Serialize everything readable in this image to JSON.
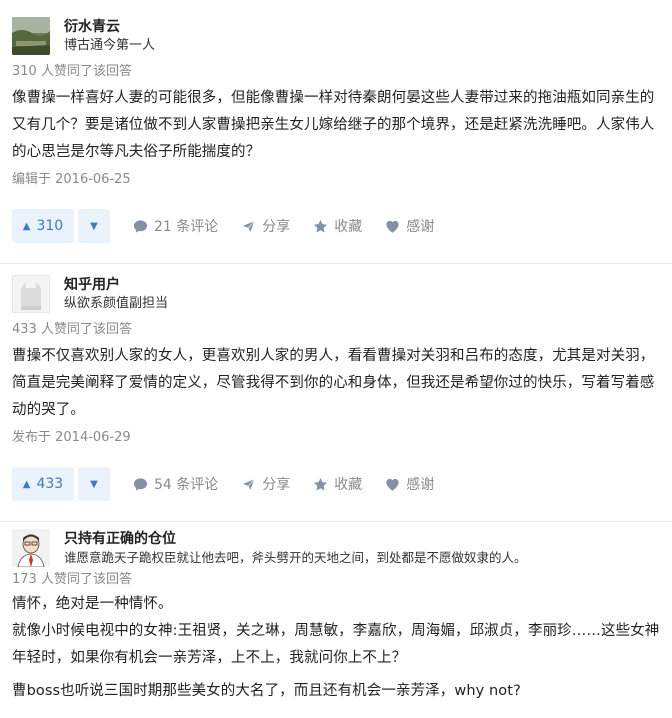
{
  "answers": [
    {
      "author": {
        "name": "衍水青云",
        "bio": "博古通今第一人"
      },
      "votes_line": "310 人赞同了该回答",
      "content": [
        "像曹操一样喜好人妻的可能很多，但能像曹操一样对待秦朗何晏这些人妻带过来的拖油瓶如同亲生的又有几个？要是诸位做不到人家曹操把亲生女儿嫁给继子的那个境界，还是赶紧洗洗睡吧。人家伟人的心思岂是尔等凡夫俗子所能揣度的？"
      ],
      "date": "编辑于 2016-06-25",
      "upvotes": "310",
      "comments": "21 条评论",
      "share": "分享",
      "favorite": "收藏",
      "thanks": "感谢"
    },
    {
      "author": {
        "name": "知乎用户",
        "bio": "纵欲系颜值副担当"
      },
      "votes_line": "433 人赞同了该回答",
      "content": [
        "曹操不仅喜欢别人家的女人，更喜欢别人家的男人，看看曹操对关羽和吕布的态度，尤其是对关羽，简直是完美阐释了爱情的定义，尽管我得不到你的心和身体，但我还是希望你过的快乐，写着写着感动的哭了。"
      ],
      "date": "发布于 2014-06-29",
      "upvotes": "433",
      "comments": "54 条评论",
      "share": "分享",
      "favorite": "收藏",
      "thanks": "感谢"
    },
    {
      "author": {
        "name": "只持有正确的仓位",
        "bio": "谁愿意跪天子跪权臣就让他去吧，斧头劈开的天地之间，到处都是不愿做奴隶的人。"
      },
      "votes_line": "173 人赞同了该回答",
      "content": [
        "情怀，绝对是一种情怀。",
        "就像小时候电视中的女神:王祖贤，关之琳，周慧敏，李嘉欣，周海媚，邱淑贞，李丽珍……这些女神年轻时，如果你有机会一亲芳泽，上不上，我就问你上不上？",
        "曹boss也听说三国时期那些美女的大名了，而且还有机会一亲芳泽，why not?"
      ]
    }
  ],
  "colors": {
    "accent": "#3e7ac2",
    "vote_bg": "#eaf2fb",
    "meta": "#8a8a8a"
  },
  "icons": [
    "comment-icon",
    "share-icon",
    "star-icon",
    "heart-icon",
    "triangle-up-icon",
    "triangle-down-icon"
  ]
}
